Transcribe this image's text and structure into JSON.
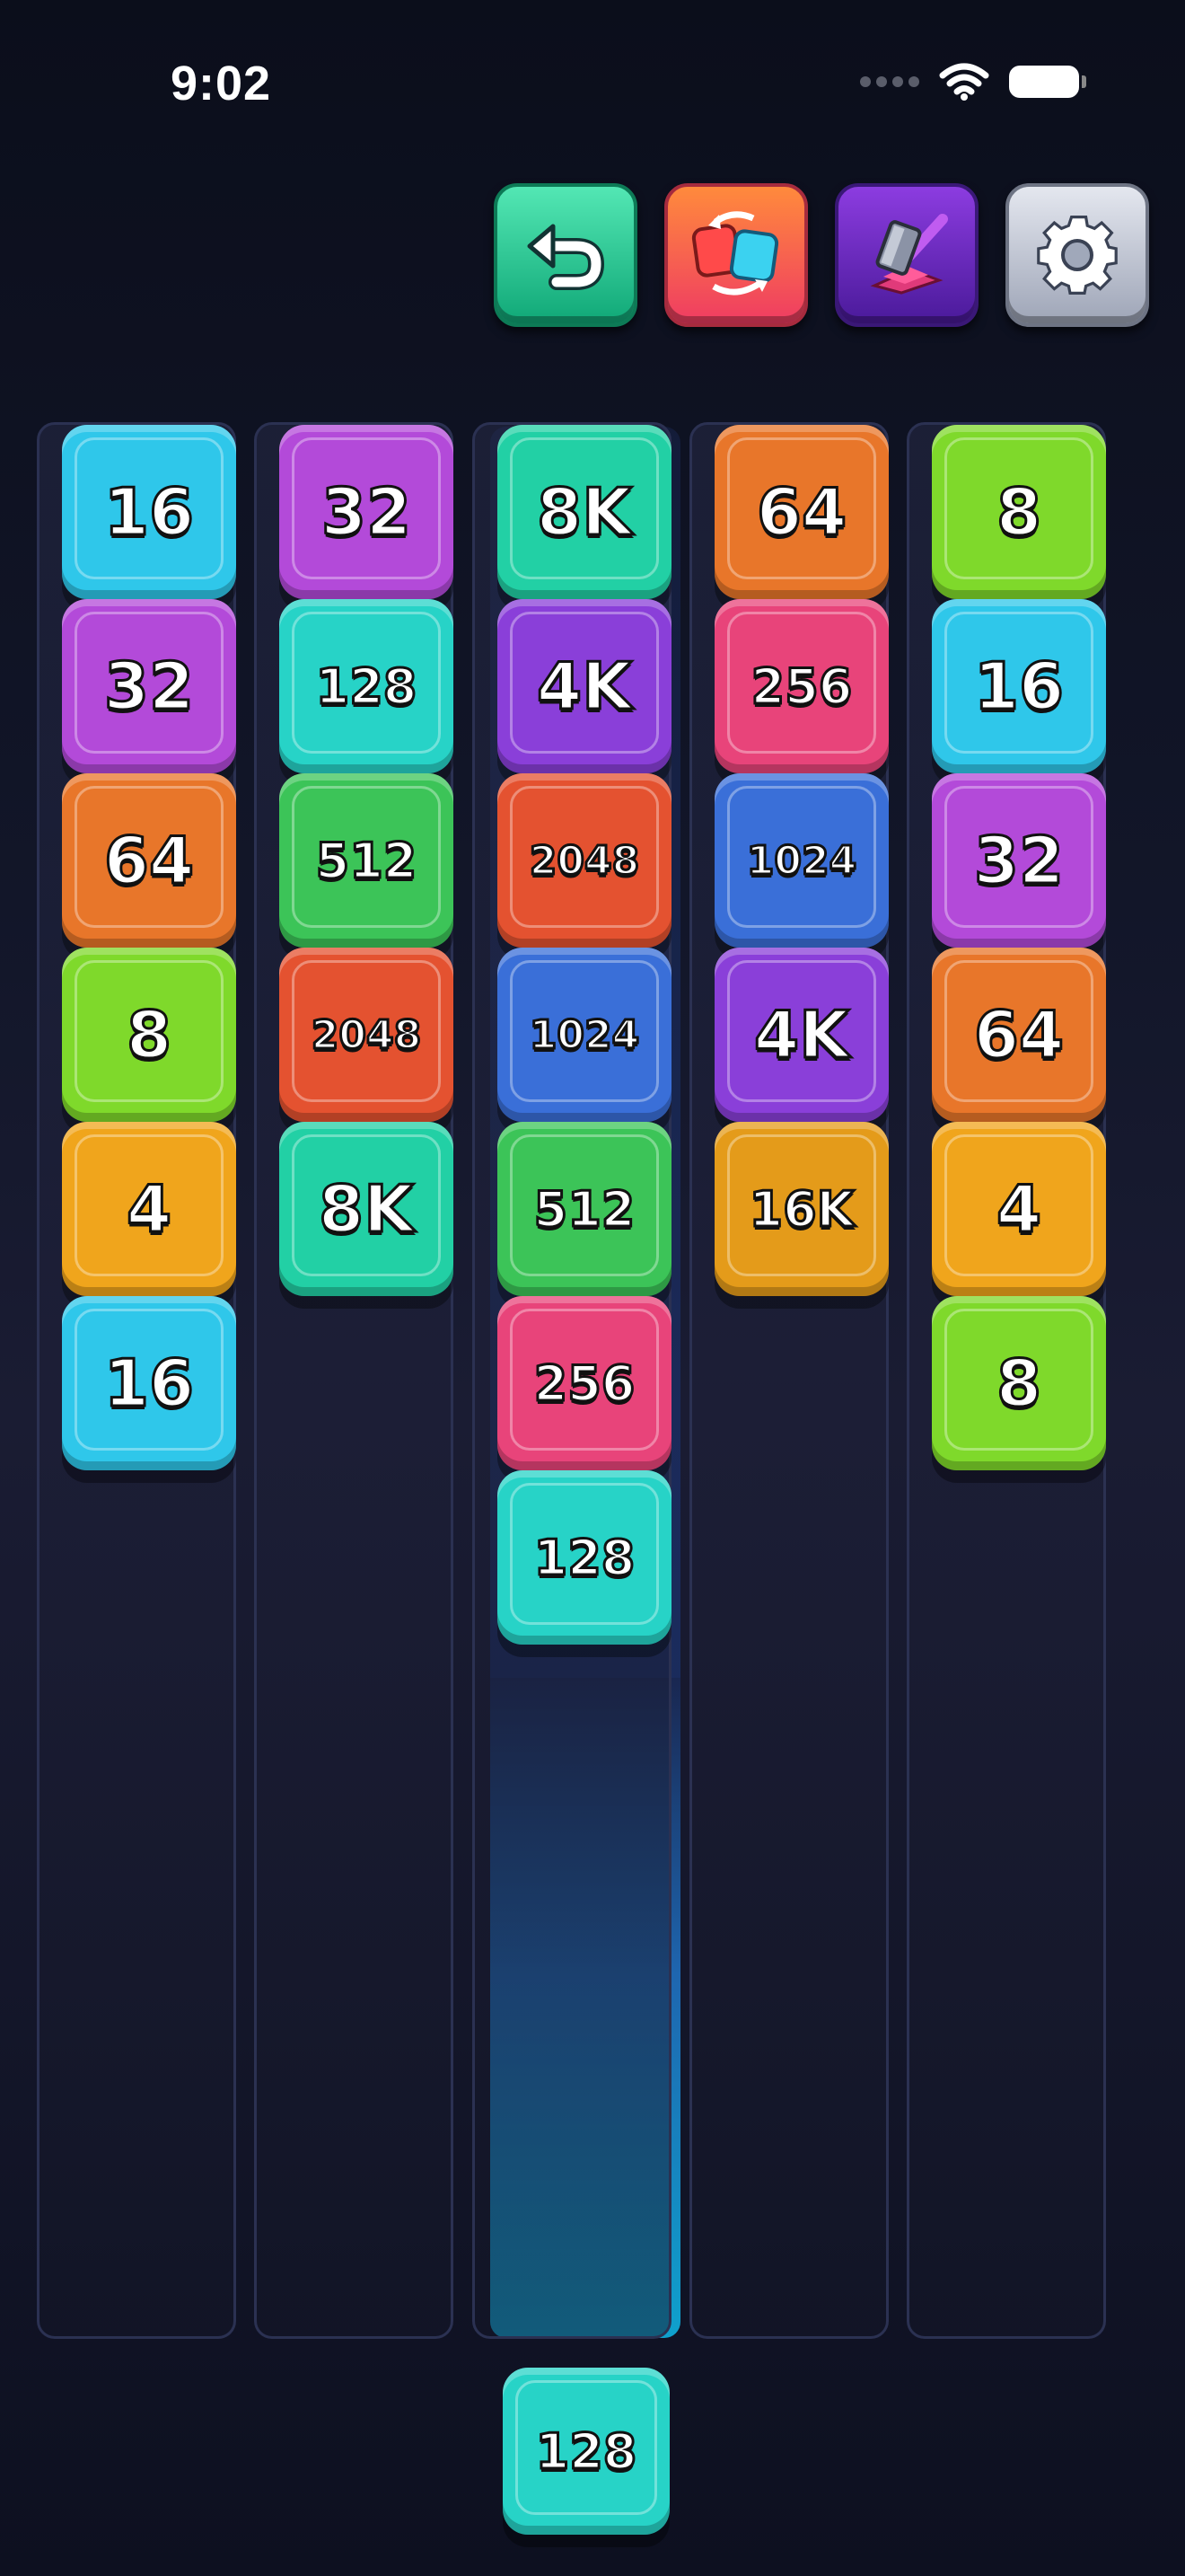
{
  "status": {
    "time": "9:02"
  },
  "toolbar": {
    "undo_icon": "undo-arrow-icon",
    "shuffle_icon": "shuffle-icon",
    "hammer_icon": "hammer-icon",
    "settings_icon": "gear-icon"
  },
  "colors": {
    "2": "#2fc7ea",
    "4": "#f0a51c",
    "8": "#7fd92b",
    "16": "#2fc7ea",
    "32": "#b34ad9",
    "64": "#e8762a",
    "128": "#27d3c7",
    "256": "#e8447a",
    "512": "#3cc458",
    "1024": "#3a6fd8",
    "2048": "#e45230",
    "4K": "#8a3fd9",
    "8K": "#22d0a5",
    "16K": "#e49b1a"
  },
  "columns": [
    {
      "tiles": [
        "16",
        "32",
        "64",
        "8",
        "4",
        "16"
      ]
    },
    {
      "tiles": [
        "32",
        "128",
        "512",
        "2048",
        "8K"
      ]
    },
    {
      "tiles": [
        "8K",
        "4K",
        "2048",
        "1024",
        "512",
        "256",
        "128"
      ]
    },
    {
      "tiles": [
        "64",
        "256",
        "1024",
        "4K",
        "16K"
      ]
    },
    {
      "tiles": [
        "8",
        "16",
        "32",
        "64",
        "4",
        "8"
      ]
    }
  ],
  "next_tile": "128"
}
